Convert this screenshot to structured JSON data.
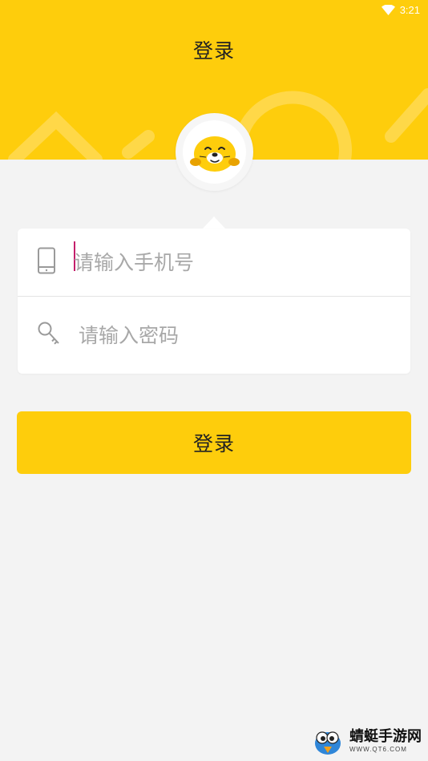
{
  "status_bar": {
    "time": "3:21",
    "icons": [
      "wifi-icon"
    ]
  },
  "header": {
    "title": "登录"
  },
  "avatar": {
    "icon": "seal-mascot-icon"
  },
  "form": {
    "phone": {
      "placeholder": "请输入手机号",
      "value": "",
      "icon": "phone-icon"
    },
    "password": {
      "placeholder": "请输入密码",
      "value": "",
      "icon": "key-icon"
    }
  },
  "login_button": {
    "label": "登录"
  },
  "watermark": {
    "text": "蜻蜓手游网",
    "subtext": "WWW.QT6.COM",
    "icon": "bird-mascot-icon"
  },
  "colors": {
    "brand_yellow": "#fecd0c",
    "background": "#f3f3f3",
    "caret": "#c41f6b"
  }
}
